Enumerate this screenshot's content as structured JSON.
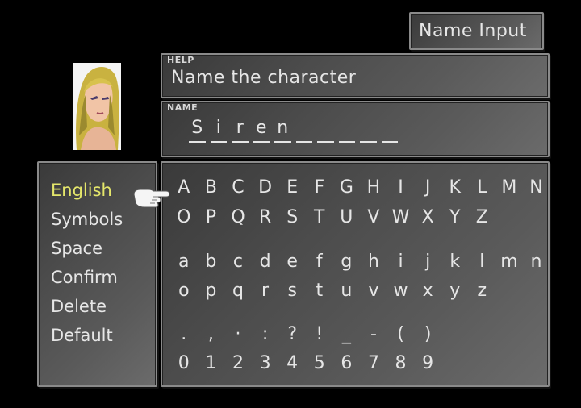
{
  "title": "Name Input",
  "help": {
    "tag": "HELP",
    "text": "Name the character"
  },
  "name": {
    "tag": "NAME",
    "slots": [
      "S",
      "i",
      "r",
      "e",
      "n",
      "",
      "",
      "",
      "",
      ""
    ]
  },
  "menu": [
    {
      "label": "English",
      "selected": true
    },
    {
      "label": "Symbols"
    },
    {
      "label": "Space"
    },
    {
      "label": "Confirm"
    },
    {
      "label": "Delete"
    },
    {
      "label": "Default"
    }
  ],
  "chars": {
    "upper1": [
      "A",
      "B",
      "C",
      "D",
      "E",
      "F",
      "G",
      "H",
      "I",
      "J",
      "K",
      "L",
      "M",
      "N"
    ],
    "upper2": [
      "O",
      "P",
      "Q",
      "R",
      "S",
      "T",
      "U",
      "V",
      "W",
      "X",
      "Y",
      "Z"
    ],
    "lower1": [
      "a",
      "b",
      "c",
      "d",
      "e",
      "f",
      "g",
      "h",
      "i",
      "j",
      "k",
      "l",
      "m",
      "n"
    ],
    "lower2": [
      "o",
      "p",
      "q",
      "r",
      "s",
      "t",
      "u",
      "v",
      "w",
      "x",
      "y",
      "z"
    ],
    "symbols": [
      ".",
      ",",
      "·",
      ":",
      "?",
      "!",
      "_",
      "-",
      "(",
      ")"
    ],
    "digits": [
      "0",
      "1",
      "2",
      "3",
      "4",
      "5",
      "6",
      "7",
      "8",
      "9"
    ]
  },
  "colors": {
    "selected": "#e4e66b",
    "text": "#e6e6e6"
  }
}
